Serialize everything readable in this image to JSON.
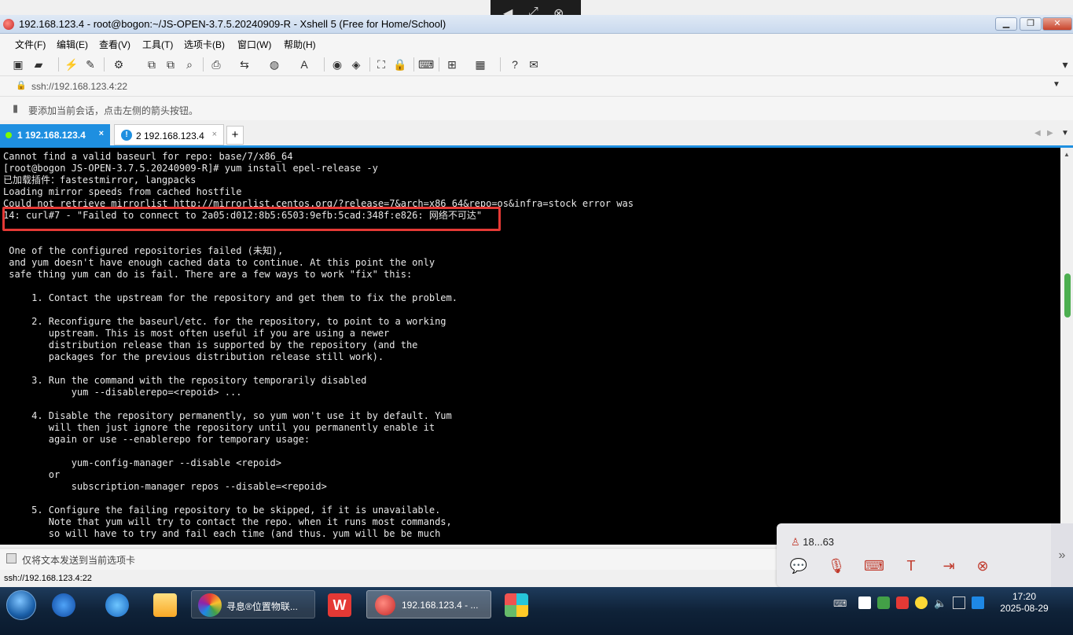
{
  "window": {
    "title": "192.168.123.4 - root@bogon:~/JS-OPEN-3.7.5.20240909-R - Xshell 5 (Free for Home/School)"
  },
  "menu": {
    "items": [
      "文件(F)",
      "编辑(E)",
      "查看(V)",
      "工具(T)",
      "选项卡(B)",
      "窗口(W)",
      "帮助(H)"
    ]
  },
  "address": {
    "value": "ssh://192.168.123.4:22"
  },
  "hint": {
    "text": "要添加当前会话，点击左侧的箭头按钮。"
  },
  "tabs": [
    {
      "label": "1 192.168.123.4",
      "active": true
    },
    {
      "label": "2 192.168.123.4",
      "active": false
    }
  ],
  "tab_add_label": "+",
  "terminal": {
    "lines": [
      "Cannot find a valid baseurl for repo: base/7/x86_64",
      "[root@bogon JS-OPEN-3.7.5.20240909-R]# yum install epel-release -y",
      "已加载插件：fastestmirror, langpacks",
      "Loading mirror speeds from cached hostfile",
      "Could not retrieve mirrorlist http://mirrorlist.centos.org/?release=7&arch=x86_64&repo=os&infra=stock error was",
      "14: curl#7 - \"Failed to connect to 2a05:d012:8b5:6503:9efb:5cad:348f:e826: 网络不可达\"",
      "",
      "",
      " One of the configured repositories failed (未知),",
      " and yum doesn't have enough cached data to continue. At this point the only",
      " safe thing yum can do is fail. There are a few ways to work \"fix\" this:",
      "",
      "     1. Contact the upstream for the repository and get them to fix the problem.",
      "",
      "     2. Reconfigure the baseurl/etc. for the repository, to point to a working",
      "        upstream. This is most often useful if you are using a newer",
      "        distribution release than is supported by the repository (and the",
      "        packages for the previous distribution release still work).",
      "",
      "     3. Run the command with the repository temporarily disabled",
      "            yum --disablerepo=<repoid> ...",
      "",
      "     4. Disable the repository permanently, so yum won't use it by default. Yum",
      "        will then just ignore the repository until you permanently enable it",
      "        again or use --enablerepo for temporary usage:",
      "",
      "            yum-config-manager --disable <repoid>",
      "        or",
      "            subscription-manager repos --disable=<repoid>",
      "",
      "     5. Configure the failing repository to be skipped, if it is unavailable.",
      "        Note that yum will try to contact the repo. when it runs most commands,",
      "        so will have to try and fail each time (and thus. yum will be be much"
    ]
  },
  "sendbar": {
    "placeholder": "仅将文本发送到当前选项卡"
  },
  "status": {
    "connection": "ssh://192.168.123.4:22"
  },
  "remote_panel": {
    "user": "18...63"
  },
  "taskbar": {
    "tasks": [
      {
        "label": "寻息®位置物联..."
      },
      {
        "label": "192.168.123.4 - ..."
      }
    ],
    "time": "17:20",
    "date": "2025-08-29"
  },
  "colors": {
    "accent": "#1e8fe0",
    "highlight_box": "#e53935",
    "terminal_bg": "#000000",
    "terminal_fg": "#e8e8e8"
  }
}
